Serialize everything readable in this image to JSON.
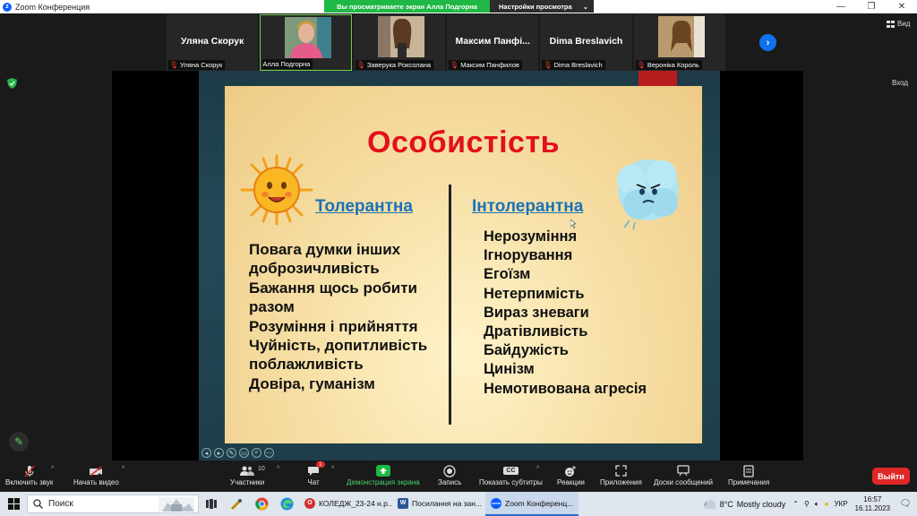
{
  "window": {
    "title": "Zoom Конференция",
    "minimize": "—",
    "maximize": "❐",
    "close": "✕"
  },
  "share_banner": {
    "viewing_text": "Вы просматриваете экран Алла Подгорна",
    "view_options": "Настройки просмотра",
    "view_options_caret": "⌄"
  },
  "participants": [
    {
      "big_name": "Уляна Скорук",
      "label": "Уляна Скорук",
      "has_video": false,
      "muted": true
    },
    {
      "big_name": "",
      "label": "Алла Подгорна",
      "has_video": true,
      "muted": false,
      "active": true
    },
    {
      "big_name": "",
      "label": "Заверука Роксолана",
      "has_video": true,
      "muted": true
    },
    {
      "big_name": "Максим  Панфі...",
      "label": "Максим Панфилов",
      "has_video": false,
      "muted": true
    },
    {
      "big_name": "Dima Breslavich",
      "label": "Dima Breslavich",
      "has_video": false,
      "muted": true
    },
    {
      "big_name": "",
      "label": "Вероніка Король",
      "has_video": true,
      "muted": true
    }
  ],
  "strip_next_icon": "›",
  "view_button": "Вид",
  "enter_button": "Вход",
  "slide": {
    "title": "Особистість",
    "tolerant_heading": "Толерантна",
    "intolerant_heading": "Інтолерантна",
    "tolerant_items": [
      "Повага думки інших",
      "доброзичливість",
      "Бажання щось робити",
      "разом",
      "Розуміння і прийняття",
      "Чуйність, допитливість",
      "поблажливість",
      "Довіра, гуманізм"
    ],
    "intolerant_items": [
      "Нерозуміння",
      "Ігнорування",
      "Егоїзм",
      "Нетерпимість",
      "Вираз зневаги",
      "Дратівливість",
      "Байдужість",
      "Цинізм",
      "Немотивована агресія"
    ]
  },
  "ppt_controls": [
    "◂",
    "▸",
    "✎",
    "▭",
    "⌕",
    "⋯"
  ],
  "toolbar": {
    "unmute": "Включить звук",
    "start_video": "Начать видео",
    "participants": "Участники",
    "participants_count": "10",
    "chat": "Чат",
    "chat_badge": "1",
    "share_screen": "Демонстрация экрана",
    "record": "Запись",
    "captions": "Показать субтитры",
    "captions_icon": "CC",
    "reactions": "Реакции",
    "apps": "Приложения",
    "whiteboards": "Доски сообщений",
    "notes": "Примечания",
    "leave": "Выйти",
    "caret": "^"
  },
  "taskbar": {
    "search_placeholder": "Поиск",
    "apps": [
      {
        "label": "КОЛЕДЖ_23-24 н.р...",
        "icon_color": "#d32f2f",
        "icon": "O",
        "active": false
      },
      {
        "label": "Посилання на зан...",
        "icon_color": "#2b5797",
        "icon": "W",
        "active": false
      },
      {
        "label": "Zoom Конференц...",
        "icon_color": "#0b5cff",
        "icon": "zoom",
        "active": true
      }
    ],
    "weather_temp": "8°C",
    "weather_desc": "Mostly cloudy",
    "language": "УКР",
    "time": "16:57",
    "date": "16.11.2023"
  },
  "colors": {
    "accent_green": "#1fb845",
    "leave_red": "#e02828",
    "slide_title_red": "#e3101c",
    "heading_blue": "#1c72b8",
    "zoom_blue": "#0b5cff"
  }
}
